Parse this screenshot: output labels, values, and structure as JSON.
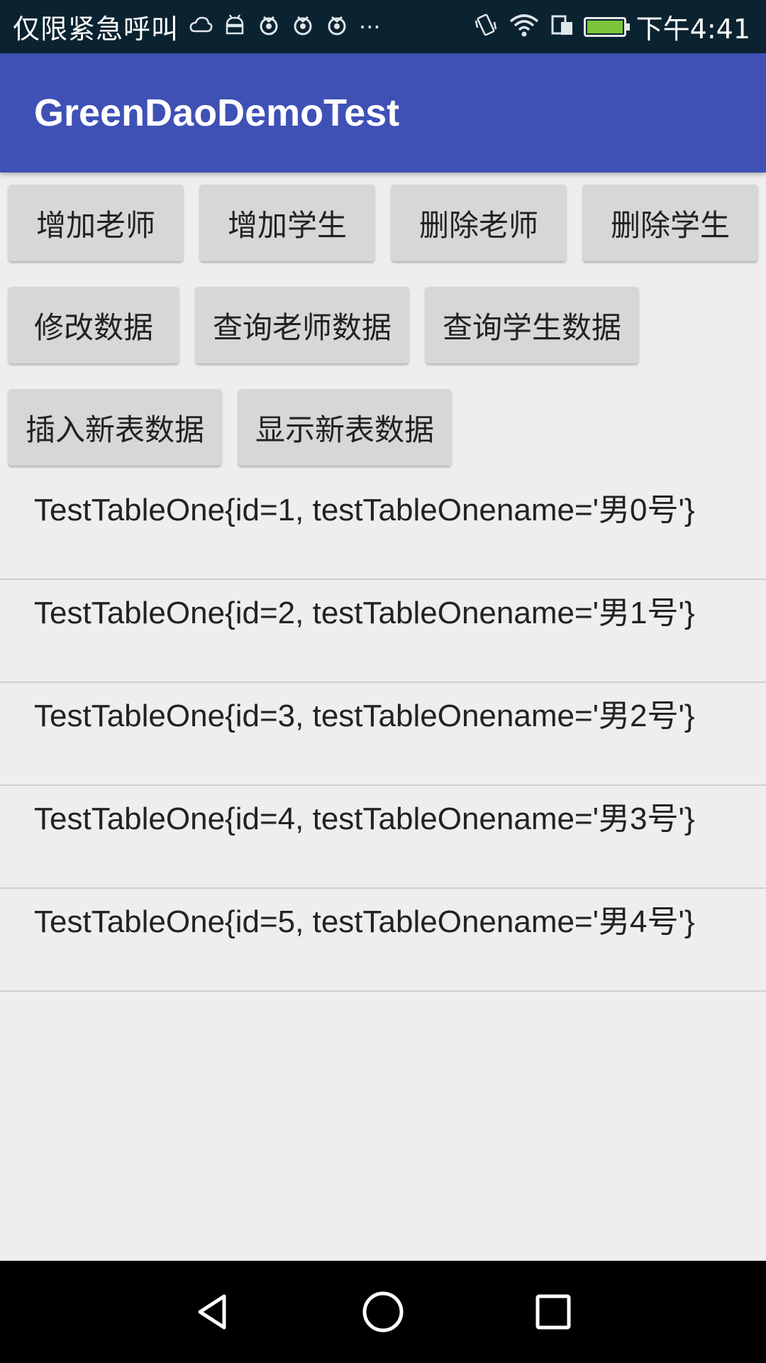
{
  "status_bar": {
    "carrier_text": "仅限紧急呼叫",
    "left_icons": [
      "weather-cloud-icon",
      "android-icon",
      "app-notification-icon",
      "app-notification-icon",
      "app-notification-icon",
      "more-dots-icon"
    ],
    "more_indicator": "···",
    "right_icons": [
      "vibrate-icon",
      "wifi-icon",
      "sim-icon",
      "battery-charging-icon"
    ],
    "time": "下午4:41"
  },
  "app_bar": {
    "title": "GreenDaoDemoTest",
    "color": "#3f51b5"
  },
  "buttons": {
    "row1": [
      "增加老师",
      "增加学生",
      "删除老师",
      "删除学生"
    ],
    "row2": [
      "修改数据",
      "查询老师数据",
      "查询学生数据"
    ],
    "row3": [
      "插入新表数据",
      "显示新表数据"
    ]
  },
  "list_items": [
    "TestTableOne{id=1, testTableOnename='男0号'}",
    "TestTableOne{id=2, testTableOnename='男1号'}",
    "TestTableOne{id=3, testTableOnename='男2号'}",
    "TestTableOne{id=4, testTableOnename='男3号'}",
    "TestTableOne{id=5, testTableOnename='男4号'}"
  ],
  "nav_bar": {
    "icons": [
      "back-icon",
      "home-icon",
      "recents-icon"
    ]
  }
}
